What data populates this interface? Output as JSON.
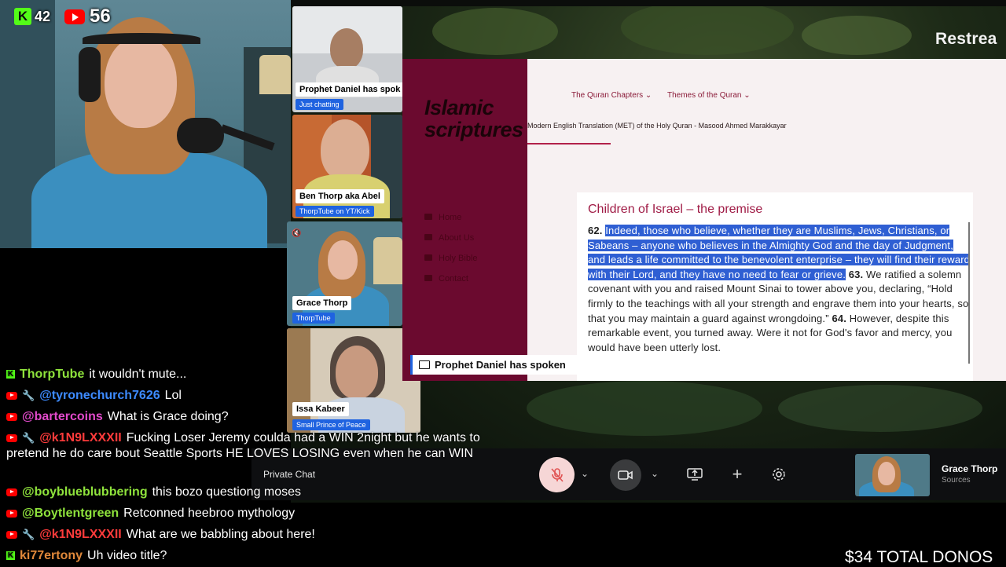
{
  "counts": {
    "kick": "42",
    "youtube": "56"
  },
  "studio": {
    "logo_text": "Restrea"
  },
  "participants": [
    {
      "name": "Prophet Daniel has spok",
      "subtitle": "Just chatting"
    },
    {
      "name": "Ben Thorp aka Abel",
      "subtitle": "ThorpTube on YT/Kick"
    },
    {
      "name": "Grace Thorp",
      "subtitle": "ThorpTube"
    },
    {
      "name": "Issa Kabeer",
      "subtitle": "Small Prince of Peace"
    }
  ],
  "screen_share": {
    "site_logo_line1": "Islamic",
    "site_logo_line2": "scriptures",
    "sidebar_links": [
      "Home",
      "About Us",
      "Holy Bible",
      "Contact"
    ],
    "nav": [
      "The Quran Chapters ⌄",
      "Themes of the Quran ⌄"
    ],
    "caption": "Modern English Translation (MET) of the Holy Quran - Masood Ahmed Marakkayar",
    "section_title": "Children of Israel – the premise",
    "verse62_num": "62.",
    "verse62_text": "Indeed, those who believe, whether they are Muslims, Jews, Christians, or Sabeans – anyone who believes in the Almighty God and the day of Judgment, and leads a life committed to the benevolent enterprise – they will find their reward with their Lord, and they have no need to fear or grieve.",
    "verse63_num": "63.",
    "verse63_text": "We ratified a solemn covenant with you and raised Mount Sinai to tower above you, declaring, “Hold firmly to the teachings with all your strength and engrave them into your hearts, so that you may maintain a guard against wrongdoing.”",
    "verse64_num": "64.",
    "verse64_text": "However, despite this remarkable event, you turned away. Were it not for God's favor and mercy, you would have been utterly lost."
  },
  "speaking_banner": "Prophet Daniel has spoken",
  "controls": {
    "private_chat": "Private Chat",
    "self_name": "Grace Thorp",
    "self_sub": "Sources"
  },
  "chat": [
    {
      "platform": "kick",
      "mod": false,
      "user": "ThorpTube",
      "color": "#8fe33c",
      "text": "it wouldn't mute..."
    },
    {
      "platform": "youtube",
      "mod": true,
      "user": "@tyronechurch7626",
      "color": "#3d8bff",
      "text": "Lol"
    },
    {
      "platform": "youtube",
      "mod": false,
      "user": "@bartercoins",
      "color": "#e24acb",
      "text": "What is Grace doing?"
    },
    {
      "platform": "youtube",
      "mod": true,
      "user": "@k1N9LXXXII",
      "color": "#ff3b3b",
      "text": "Fucking Loser Jeremy coulda had a WIN 2night but he wants to pretend he do care bout Seattle Sports HE LOVES LOSING even when he can WIN"
    },
    {
      "platform": "youtube",
      "mod": false,
      "user": "@boyblueblubbering",
      "color": "#8fe33c",
      "text": "this bozo questiong moses"
    },
    {
      "platform": "youtube",
      "mod": false,
      "user": "@Boytlentgreen",
      "color": "#8fe33c",
      "text": "Retconned heebroo mythology"
    },
    {
      "platform": "youtube",
      "mod": true,
      "user": "@k1N9LXXXII",
      "color": "#ff3b3b",
      "text": "What are we babbling about here!"
    },
    {
      "platform": "kick",
      "mod": false,
      "user": "ki77ertony",
      "color": "#e0883a",
      "text": "Uh video title?"
    }
  ],
  "donos": "$34 TOTAL DONOS"
}
